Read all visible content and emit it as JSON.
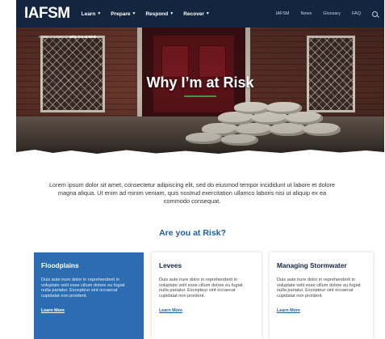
{
  "nav": {
    "logo": "IAFSM",
    "main_items": [
      {
        "label": "Learn"
      },
      {
        "label": "Prepare"
      },
      {
        "label": "Respond"
      },
      {
        "label": "Recover"
      }
    ],
    "right_items": [
      {
        "label": "IAFSM"
      },
      {
        "label": "News"
      },
      {
        "label": "Glossary"
      },
      {
        "label": "FAQ"
      }
    ],
    "search_icon": "search-icon"
  },
  "hero": {
    "breadcrumb": [
      "Home",
      "Learn",
      "Why I'm at Risk"
    ],
    "title": "Why I’m at Risk",
    "accent_color": "#3f9a3a"
  },
  "intro": {
    "text": "Lorem ipsum dolor sit amet, consectetur adipiscing elit, sed do eiusmod tempor incididunt ut labore et dolore magna aliqua. Ut enim ad minim veniam, quis nostrud exercitation ullamco laboris nisi ut aliquip ex ea commodo consequat."
  },
  "section": {
    "title": "Are you at Risk?"
  },
  "cards": [
    {
      "title": "Floodplains",
      "body": "Duis aute irure dolor in reprehenderit in voluptate velit esse cillum dolore eu fugiat nulla pariatur. Excepteur sint occaecat cupidatat non proident.",
      "link": "Learn More"
    },
    {
      "title": "Levees",
      "body": "Duis aute irure dolor in reprehenderit in voluptate velit esse cillum dolore eu fugiat nulla pariatur. Excepteur sint occaecat cupidatat non proident.",
      "link": "Learn More"
    },
    {
      "title": "Managing Stormwater",
      "body": "Duis aute irure dolor in reprehenderit in voluptate velit esse cillum dolore eu fugiat nulla pariatur. Excepteur sint occaecat cupidatat non proident.",
      "link": "Learn More"
    }
  ],
  "colors": {
    "nav_bg": "#13253f",
    "primary_blue": "#2c6db2",
    "heading_blue": "#1f5fa3"
  }
}
